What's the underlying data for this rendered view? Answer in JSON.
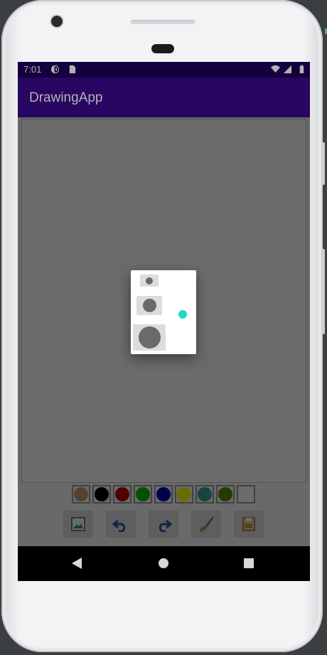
{
  "status_bar": {
    "time": "7:01",
    "icons": [
      "notification-icon",
      "sd-card-icon",
      "wifi-icon",
      "signal-icon",
      "battery-icon"
    ]
  },
  "app_bar": {
    "title": "DrawingApp"
  },
  "palette": {
    "colors": [
      "#c8a07a",
      "#000000",
      "#c40000",
      "#00c400",
      "#0000c4",
      "#ffff00",
      "#3aa39a",
      "#5c8c00",
      "#ffffff"
    ]
  },
  "toolbar": {
    "tools": [
      "gallery-icon",
      "undo-icon",
      "redo-icon",
      "brush-icon",
      "save-icon"
    ]
  },
  "brush_size_dialog": {
    "options": [
      "small-brush",
      "medium-brush",
      "large-brush"
    ]
  },
  "navigation": {
    "buttons": [
      "back-icon",
      "home-icon",
      "recents-icon"
    ]
  },
  "colors": {
    "status_bar": "#1b0258",
    "app_bar": "#3a0a8c",
    "cursor_dot": "#1ed6cc"
  }
}
